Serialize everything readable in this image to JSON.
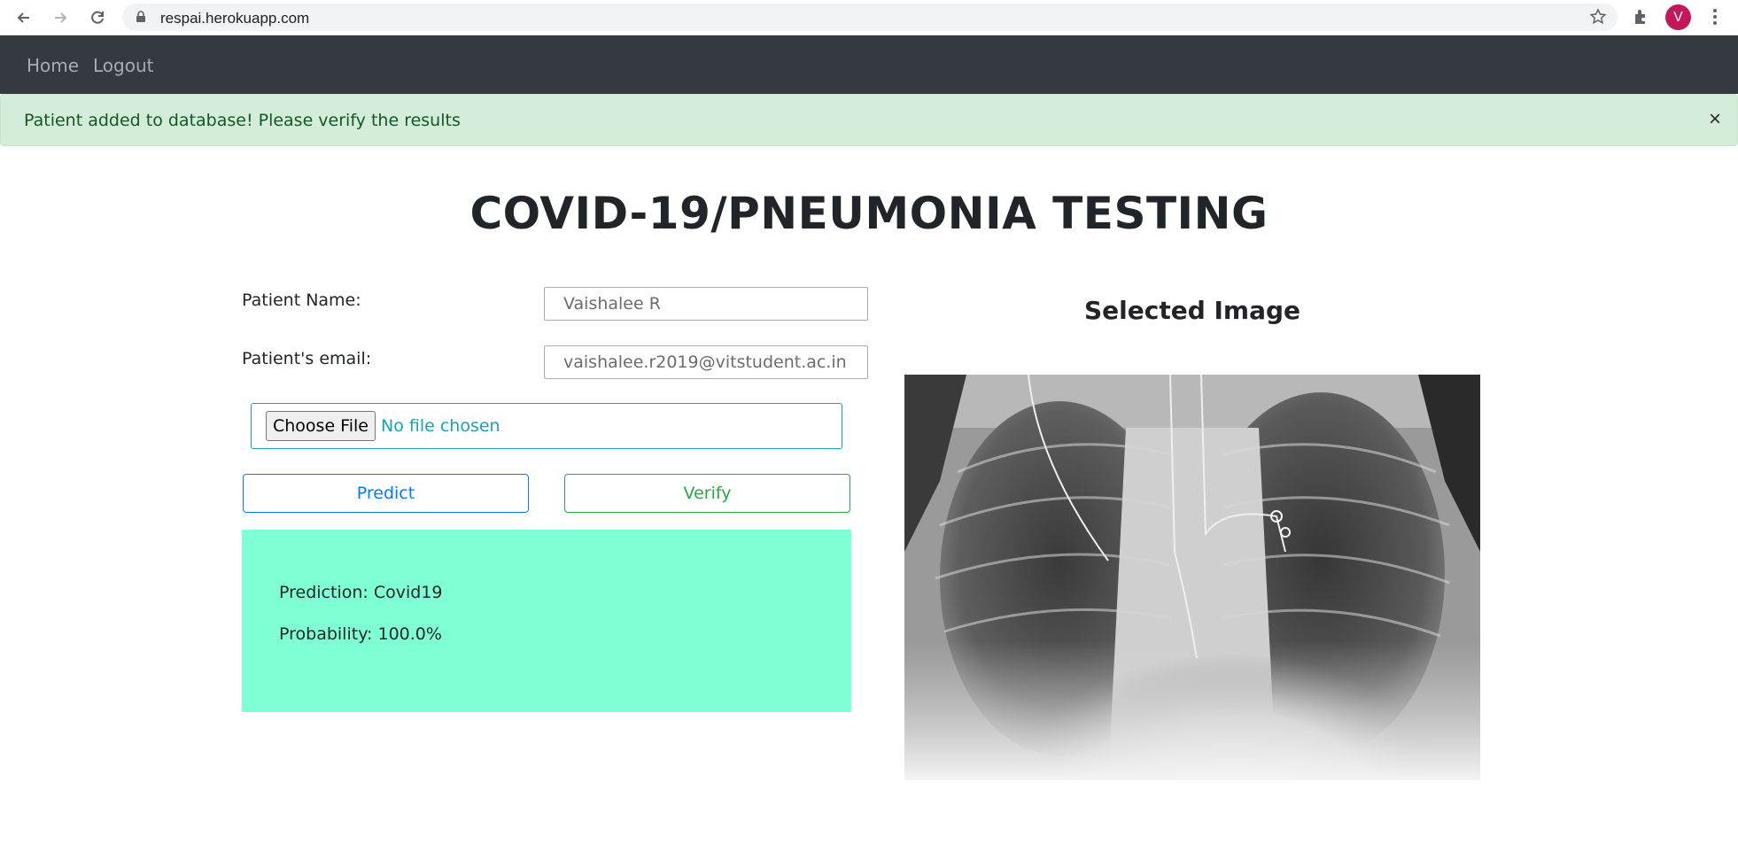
{
  "browser": {
    "url": "respai.herokuapp.com",
    "profile_initial": "V"
  },
  "nav": {
    "home": "Home",
    "logout": "Logout"
  },
  "alert": {
    "message": "Patient added to database! Please verify the results",
    "close": "×"
  },
  "page": {
    "title": "COVID-19/PNEUMONIA TESTING"
  },
  "form": {
    "name_label": "Patient Name:",
    "name_value": "Vaishalee R",
    "email_label": "Patient's email:",
    "email_value": "vaishalee.r2019@vitstudent.ac.in",
    "file_button": "Choose File",
    "file_status": "No file chosen",
    "predict_label": "Predict",
    "verify_label": "Verify"
  },
  "result": {
    "prediction": "Prediction: Covid19",
    "probability": "Probability: 100.0%"
  },
  "image_panel": {
    "title": "Selected Image"
  },
  "colors": {
    "navbar": "#343a40",
    "alert_bg": "#d4edda",
    "alert_text": "#155724",
    "result_bg": "#7fffd4",
    "predict": "#007bff",
    "verify": "#28a745",
    "file_border": "#17a2b8",
    "profile": "#c2185b"
  }
}
